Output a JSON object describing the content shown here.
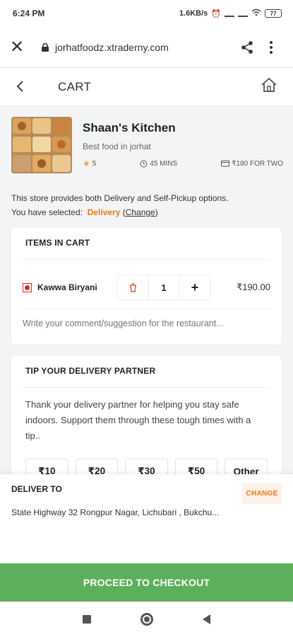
{
  "status_bar": {
    "time": "6:24 PM",
    "speed": "1.6KB/s",
    "battery": "77"
  },
  "browser": {
    "url": "jorhatfoodz.xtraderny.com"
  },
  "header": {
    "title": "CART"
  },
  "restaurant": {
    "name": "Shaan's Kitchen",
    "tagline": "Best food in jorhat",
    "rating": "5",
    "time": "45 MINS",
    "cost": "₹180 FOR TWO"
  },
  "delivery_note": {
    "line1": "This store provides both Delivery and Self-Pickup options.",
    "line2_prefix": "You have selected:",
    "selected": "Delivery",
    "change_open": "(",
    "change_label": "Change",
    "change_close": ")"
  },
  "cart": {
    "title": "ITEMS IN CART",
    "items": [
      {
        "name": "Kawwa Biryani",
        "qty": "1",
        "price": "₹190.00"
      }
    ],
    "comment_placeholder": "Write your comment/suggestion for the restaurant..."
  },
  "tip": {
    "title": "TIP YOUR DELIVERY PARTNER",
    "text": "Thank your delivery partner for helping you stay safe indoors. Support them through these tough times with a tip..",
    "options": [
      "₹10",
      "₹20",
      "₹30",
      "₹50",
      "Other"
    ]
  },
  "deliver_to": {
    "title": "DELIVER TO",
    "change_label": "CHANGE",
    "address": "State Highway 32 Rongpur Nagar, Lichubari , Bukchu..."
  },
  "checkout": {
    "label": "PROCEED TO CHECKOUT"
  },
  "colors": {
    "accent": "#f07b15",
    "checkout_green": "#5db05b",
    "veg_marker": "#d62b2b"
  }
}
